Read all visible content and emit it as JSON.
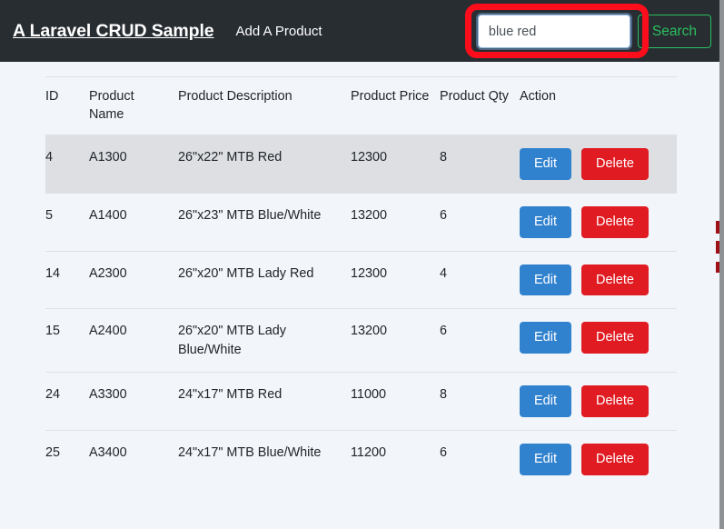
{
  "navbar": {
    "brand": "A Laravel CRUD Sample",
    "links": [
      {
        "label": "Add A Product",
        "name": "nav-add-a-product"
      }
    ],
    "search": {
      "value": "blue red",
      "placeholder": "",
      "button_label": "Search",
      "highlight_color": "#fc0d1b",
      "button_color": "#2bbf5e"
    },
    "background_color": "#282d32"
  },
  "table": {
    "headers": [
      "ID",
      "Product Name",
      "Product Description",
      "Product Price",
      "Product Qty",
      "Action"
    ],
    "action_labels": {
      "edit": "Edit",
      "delete": "Delete"
    },
    "colors": {
      "edit": "#3182ce",
      "delete": "#e01b22",
      "active_row": "#dddfe2"
    },
    "rows": [
      {
        "id": "4",
        "name": "A1300",
        "description": "26\"x22\" MTB Red",
        "price": "12300",
        "qty": "8",
        "active": true
      },
      {
        "id": "5",
        "name": "A1400",
        "description": "26\"x23\" MTB Blue/White",
        "price": "13200",
        "qty": "6",
        "active": false
      },
      {
        "id": "14",
        "name": "A2300",
        "description": "26\"x20\" MTB Lady Red",
        "price": "12300",
        "qty": "4",
        "active": false
      },
      {
        "id": "15",
        "name": "A2400",
        "description": "26\"x20\" MTB Lady Blue/White",
        "price": "13200",
        "qty": "6",
        "active": false
      },
      {
        "id": "24",
        "name": "A3300",
        "description": "24\"x17\" MTB Red",
        "price": "11000",
        "qty": "8",
        "active": false
      },
      {
        "id": "25",
        "name": "A3400",
        "description": "24\"x17\" MTB Blue/White",
        "price": "11200",
        "qty": "6",
        "active": false
      }
    ]
  },
  "page": {
    "background_color": "#f2f6fa"
  }
}
